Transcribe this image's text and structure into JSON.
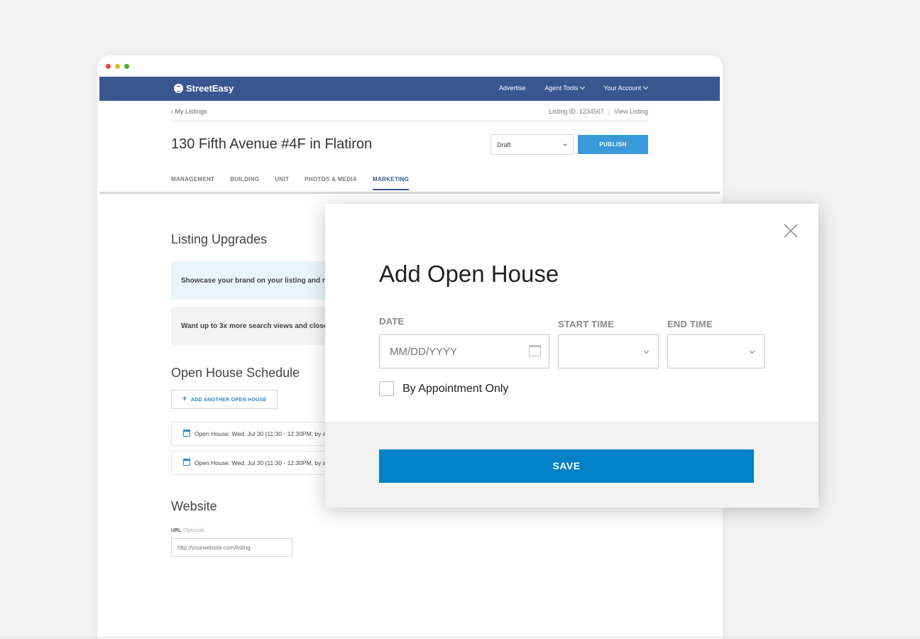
{
  "nav": {
    "brand": "StreetEasy",
    "links": [
      {
        "label": "Advertise"
      },
      {
        "label": "Agent Tools"
      },
      {
        "label": "Your Account"
      }
    ]
  },
  "subheader": {
    "breadcrumb": "My Listings",
    "listing_id": "Listing ID: 1234567",
    "view_listing": "View Listing"
  },
  "listing": {
    "title": "130 Fifth Avenue #4F in Flatiron",
    "status": "Draft",
    "publish_label": "PUBLISH"
  },
  "tabs": [
    {
      "label": "MANAGEMENT"
    },
    {
      "label": "BUILDING"
    },
    {
      "label": "UNIT"
    },
    {
      "label": "PHOTOS & MEDIA"
    },
    {
      "label": "MARKETING",
      "active": true
    }
  ],
  "upgrades": {
    "heading": "Listing Upgrades",
    "banner_blue": "Showcase your brand on your listing and re",
    "banner_grey": "Want up to 3x more search views and close t"
  },
  "open_house": {
    "heading": "Open House Schedule",
    "add_label": "ADD ANOTHER OPEN HOUSE",
    "items": [
      {
        "text": "Open House: Wed, Jul 30 (11:30 - 12:30PM, by a"
      },
      {
        "text": "Open House: Wed, Jul 30 (11:30 - 12:30PM, by a"
      }
    ]
  },
  "website": {
    "heading": "Website",
    "url_label": "URL",
    "url_optional": "(Optional)",
    "url_placeholder": "http://yourwebsite.com/listing"
  },
  "modal": {
    "title": "Add Open House",
    "date_label": "DATE",
    "date_placeholder": "MM/DD/YYYY",
    "start_time_label": "START TIME",
    "end_time_label": "END TIME",
    "appointment_label": "By Appointment Only",
    "save_label": "SAVE"
  },
  "colors": {
    "nav_bg": "#3a5690",
    "publish_bg": "#3a9ad9",
    "save_bg": "#0081c8",
    "link_blue": "#2d84c4"
  },
  "icons": [
    "logo-icon",
    "chevron-down-icon",
    "chevron-left-icon",
    "plus-icon",
    "calendar-icon",
    "close-icon"
  ]
}
